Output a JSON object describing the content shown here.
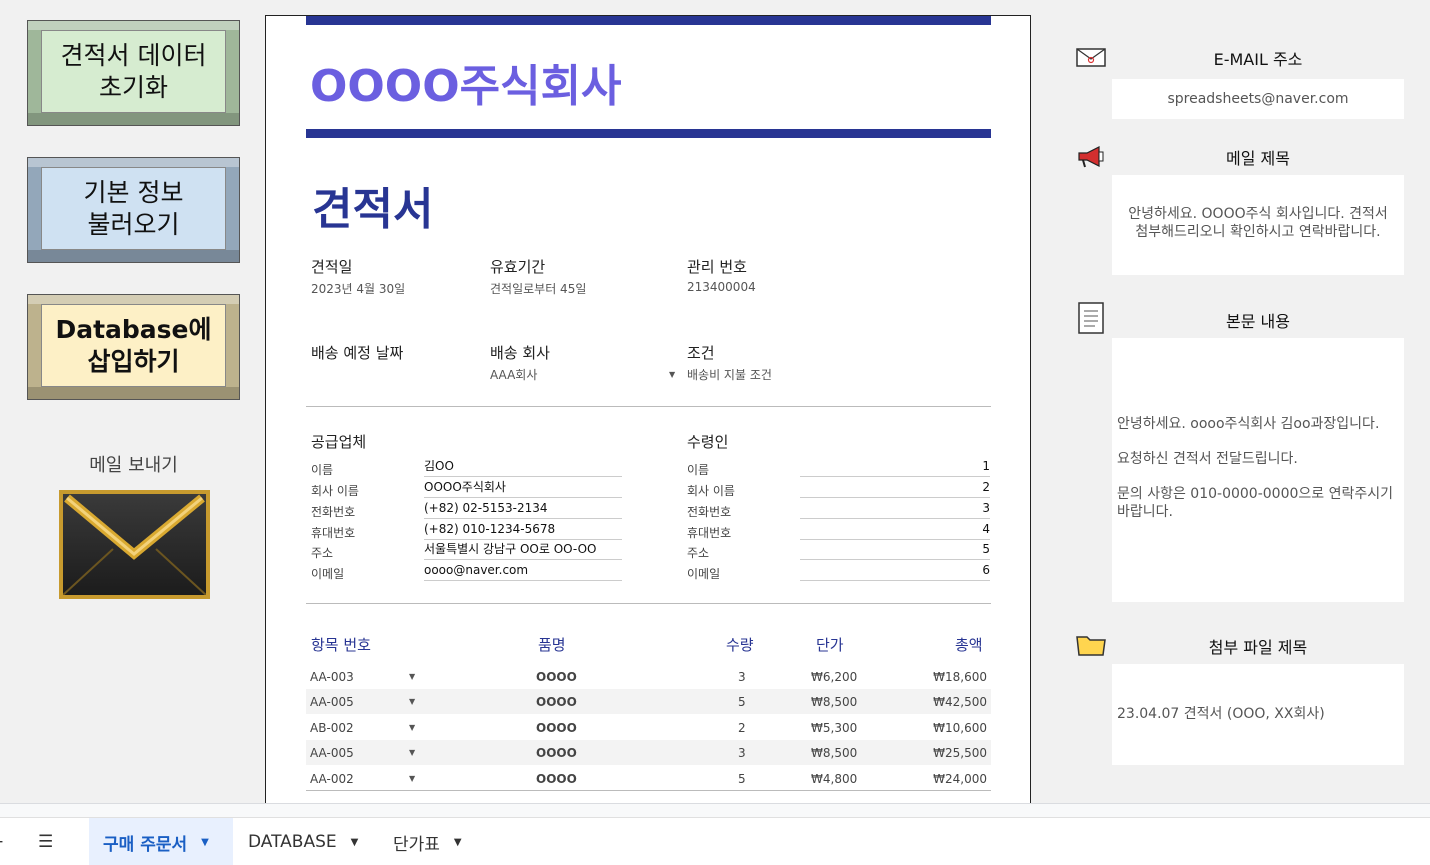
{
  "buttons": {
    "reset": {
      "line1": "견적서 데이터",
      "line2": "초기화"
    },
    "load": {
      "line1": "기본 정보",
      "line2": "불러오기"
    },
    "insert": {
      "line1": "Database에",
      "line2": "삽입하기"
    },
    "send_label": "메일 보내기"
  },
  "sheet": {
    "company": "OOOO주식회사",
    "title": "견적서",
    "fields": [
      {
        "label": "견적일",
        "value": "2023년 4월 30일"
      },
      {
        "label": "유효기간",
        "value": "견적일로부터 45일"
      },
      {
        "label": "관리 번호",
        "value": "213400004"
      },
      {
        "label": "배송 예정 날짜",
        "value": ""
      },
      {
        "label": "배송 회사",
        "value": "AAA회사"
      },
      {
        "label": "조건",
        "value": "배송비 지불 조건"
      }
    ],
    "supplier": {
      "title": "공급업체",
      "rows": [
        {
          "label": "이름",
          "value": "김OO"
        },
        {
          "label": "회사 이름",
          "value": "OOOO주식회사"
        },
        {
          "label": "전화번호",
          "value": "(+82) 02-5153-2134"
        },
        {
          "label": "휴대번호",
          "value": "(+82) 010-1234-5678"
        },
        {
          "label": "주소",
          "value": "서울특별시 강남구 OO로 OO-OO"
        },
        {
          "label": "이메일",
          "value": "oooo@naver.com"
        }
      ]
    },
    "recipient": {
      "title": "수령인",
      "rows": [
        {
          "label": "이름",
          "value": "1"
        },
        {
          "label": "회사 이름",
          "value": "2"
        },
        {
          "label": "전화번호",
          "value": "3"
        },
        {
          "label": "휴대번호",
          "value": "4"
        },
        {
          "label": "주소",
          "value": "5"
        },
        {
          "label": "이메일",
          "value": "6"
        }
      ]
    },
    "table": {
      "headers": {
        "item_no": "항목 번호",
        "name": "품명",
        "qty": "수량",
        "price": "단가",
        "total": "총액"
      },
      "rows": [
        {
          "item": "AA-003",
          "name": "OOOO",
          "qty": "3",
          "price": "₩6,200",
          "total": "₩18,600"
        },
        {
          "item": "AA-005",
          "name": "OOOO",
          "qty": "5",
          "price": "₩8,500",
          "total": "₩42,500"
        },
        {
          "item": "AB-002",
          "name": "OOOO",
          "qty": "2",
          "price": "₩5,300",
          "total": "₩10,600"
        },
        {
          "item": "AA-005",
          "name": "OOOO",
          "qty": "3",
          "price": "₩8,500",
          "total": "₩25,500"
        },
        {
          "item": "AA-002",
          "name": "OOOO",
          "qty": "5",
          "price": "₩4,800",
          "total": "₩24,000"
        }
      ]
    }
  },
  "mail": {
    "email_label": "E-MAIL 주소",
    "email_value": "spreadsheets@naver.com",
    "subject_label": "메일 제목",
    "subject_value": "안녕하세요. OOOO주식 회사입니다. 견적서 첨부해드리오니 확인하시고 연락바랍니다.",
    "body_label": "본문 내용",
    "body_line1": "안녕하세요. oooo주식회사 김oo과장입니다.",
    "body_line2": "요청하신 견적서 전달드립니다.",
    "body_line3": "문의 사항은 010-0000-0000으로 연락주시기 바랍니다.",
    "attach_label": "첨부 파일 제목",
    "attach_value": "23.04.07 견적서 (OOO, XX회사)"
  },
  "tabs": [
    "구매 주문서",
    "DATABASE",
    "단가표"
  ],
  "colors": {
    "navy": "#283593",
    "company": "#6b5fe0",
    "active_tab": "#1a5fc4"
  }
}
